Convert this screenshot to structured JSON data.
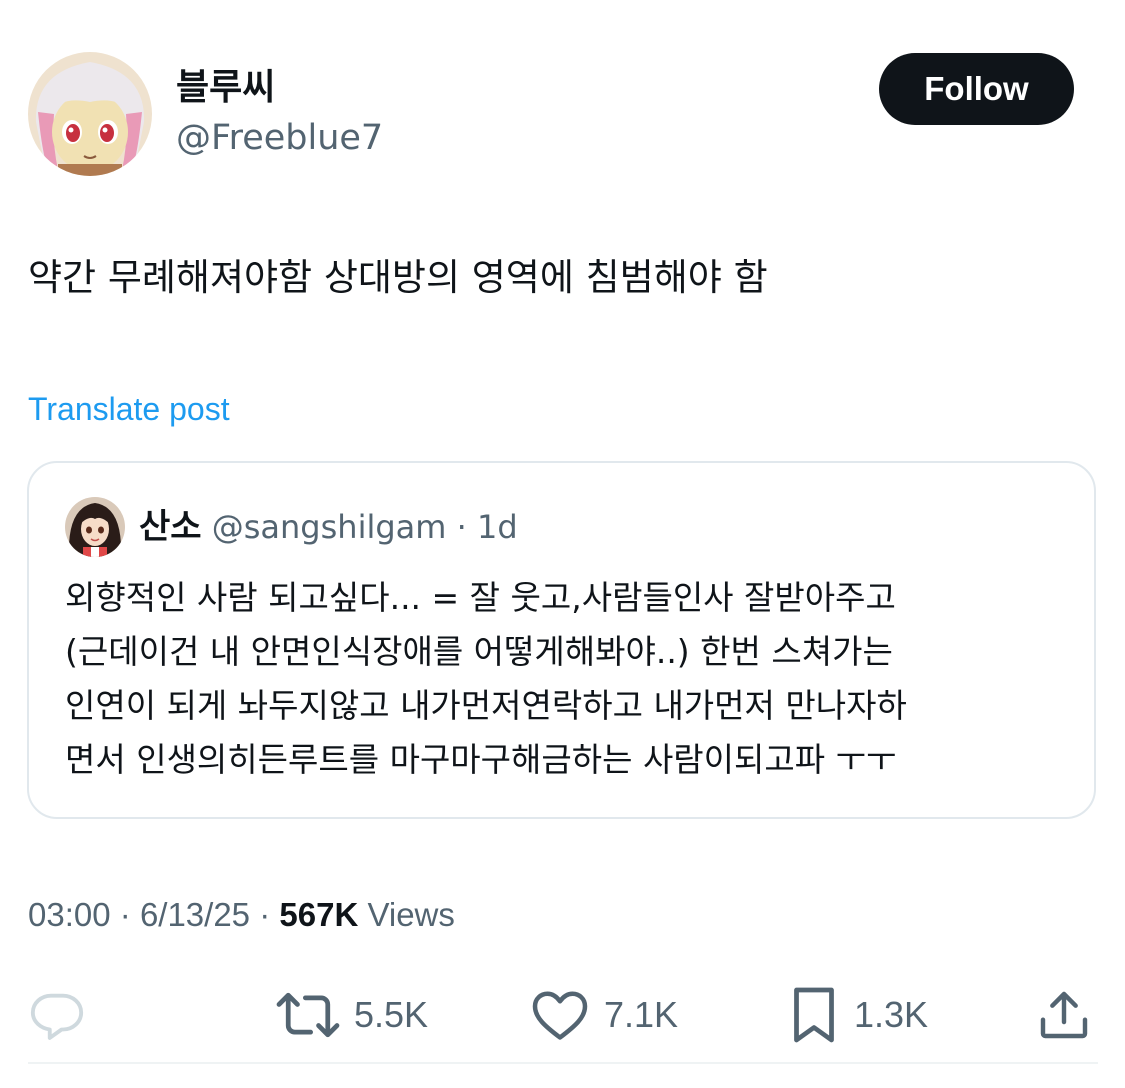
{
  "author": {
    "display_name": "블루씨",
    "handle": "@Freeblue7",
    "avatar_icon": "anime-girl-avatar"
  },
  "follow_button": {
    "label": "Follow"
  },
  "post": {
    "text": "약간 무례해져야함 상대방의 영역에 침범해야 함",
    "translate_label": "Translate post"
  },
  "quoted_post": {
    "display_name": "산소",
    "handle": "@sangshilgam",
    "separator": "·",
    "time": "1d",
    "lines": [
      "외향적인 사람 되고싶다... = 잘 웃고,사람들인사 잘받아주고",
      "(근데이건 내 안면인식장애를 어떻게해봐야..)  한번 스쳐가는",
      "인연이 되게 놔두지않고 내가먼저연락하고 내가먼저 만나자하",
      "면서 인생의히든루트를 마구마구해금하는 사람이되고파 ㅜㅜ"
    ]
  },
  "meta": {
    "time": "03:00",
    "separator": "·",
    "date": "6/13/25",
    "views_count": "567K",
    "views_label": "Views"
  },
  "actions": {
    "reply": {
      "icon": "reply-icon",
      "count": ""
    },
    "repost": {
      "icon": "repost-icon",
      "count": "5.5K"
    },
    "like": {
      "icon": "heart-icon",
      "count": "7.1K"
    },
    "bookmark": {
      "icon": "bookmark-icon",
      "count": "1.3K"
    },
    "share": {
      "icon": "share-icon"
    }
  },
  "colors": {
    "text": "#0f1419",
    "secondary": "#536471",
    "accent": "#1d9bf0",
    "border": "#e1e8ed"
  }
}
